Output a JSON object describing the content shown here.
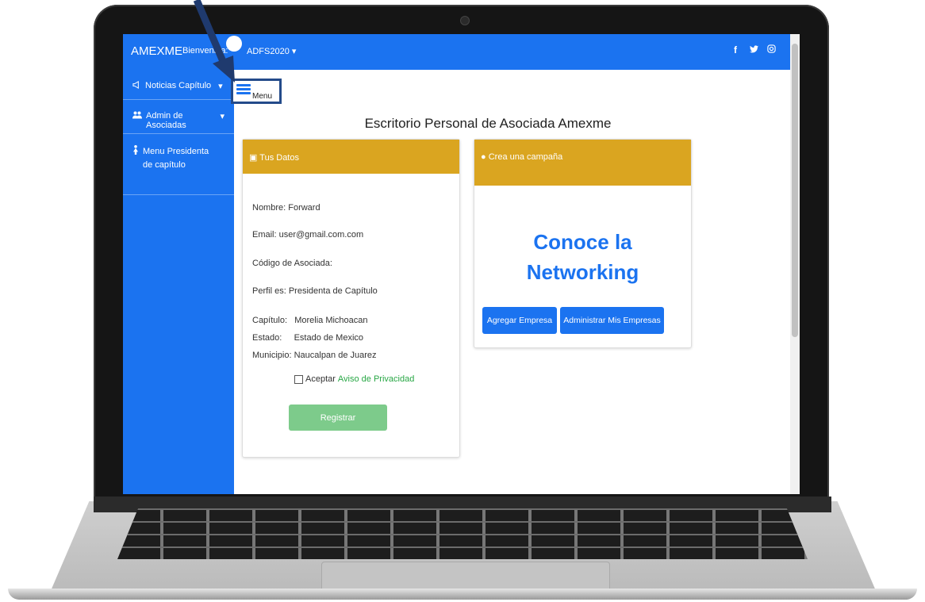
{
  "topbar": {
    "brand": "AMEXME",
    "welcome": "Bienvenida:",
    "user": "ADFS2020",
    "social": [
      "f",
      "🐦",
      "◎"
    ]
  },
  "sidebar": {
    "items": [
      {
        "label": "Noticias Capítulo",
        "icon": "megaphone-icon",
        "caret": "▾"
      },
      {
        "label": "Admin de Asociadas",
        "icon": "users-icon",
        "caret": "▾"
      },
      {
        "label": "Menu Presidenta de capítulo",
        "icon": "female-icon",
        "caret": ""
      }
    ]
  },
  "menu_button": {
    "label": "Menu"
  },
  "main": {
    "title": "Escritorio Personal de Asociada Amexme",
    "data_card": {
      "header": "Tus Datos",
      "nombre": "Nombre: Forward",
      "email": "Email: user@gmail.com.com",
      "codigo": "Código de Asociada:",
      "perfil": "Perfil es: Presidenta de Capítulo",
      "capitulo": "Capítulo:   Morelia Michoacan",
      "estado": "Estado:     Estado de Mexico",
      "municipio": "Municipio: Naucalpan de Juarez",
      "aceptar": "Aceptar",
      "privacy_link": "Aviso de Privacidad",
      "register_button": "Registrar"
    },
    "campaign_card": {
      "header": "Crea una campaña",
      "promo_line1": "Conoce la",
      "promo_line2": "Networking",
      "btn_add": "Agregar Empresa",
      "btn_admin": "Administrar Mis Empresas"
    }
  },
  "colors": {
    "primary": "#1b73f0",
    "card_header": "#daa520",
    "success_light": "#7dcb8b",
    "arrow": "#1f3a6e"
  }
}
